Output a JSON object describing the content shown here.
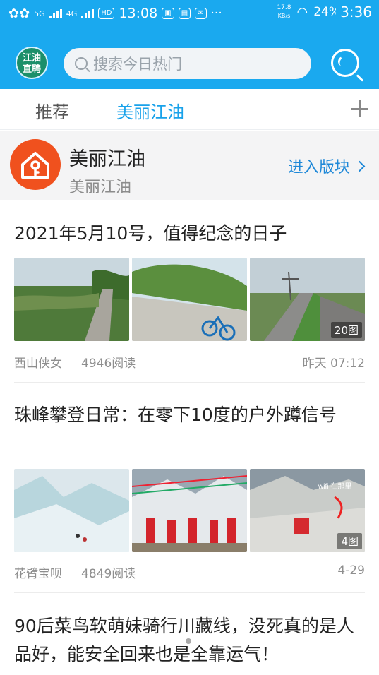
{
  "status_bar": {
    "network_1": "5G",
    "network_2": "4G",
    "hd": "HD",
    "time": "13:08",
    "speed_top": "17.8",
    "speed_bottom": "KB/s",
    "battery": "24%",
    "clock_right": "3:36"
  },
  "header": {
    "logo_line1": "江油",
    "logo_line2": "直聘",
    "search_placeholder": "搜索今日热门"
  },
  "tabs": [
    {
      "label": "推荐",
      "active": false
    },
    {
      "label": "美丽江油",
      "active": true
    }
  ],
  "section": {
    "title": "美丽江油",
    "subtitle": "美丽江油",
    "enter_label": "进入版块",
    "icon_color": "#f0511e"
  },
  "articles": [
    {
      "title": "2021年5月10号，值得纪念的日子",
      "image_count": "20图",
      "author": "西山侠女",
      "reads": "4946阅读",
      "time": "昨天 07:12"
    },
    {
      "title": "珠峰攀登日常：在零下10度的户外蹲信号",
      "image_count": "4图",
      "author": "花臂宝呗",
      "reads": "4849阅读",
      "time": "4-29",
      "image_caption": "wifi 在那里"
    },
    {
      "title": "90后菜鸟软萌妹骑行川藏线，没死真的是人品好，能安全回来也是全靠运气！"
    }
  ],
  "colors": {
    "brand_blue": "#1aa9ef",
    "active_tab": "#19a2ea",
    "link_blue": "#1e88d8"
  }
}
